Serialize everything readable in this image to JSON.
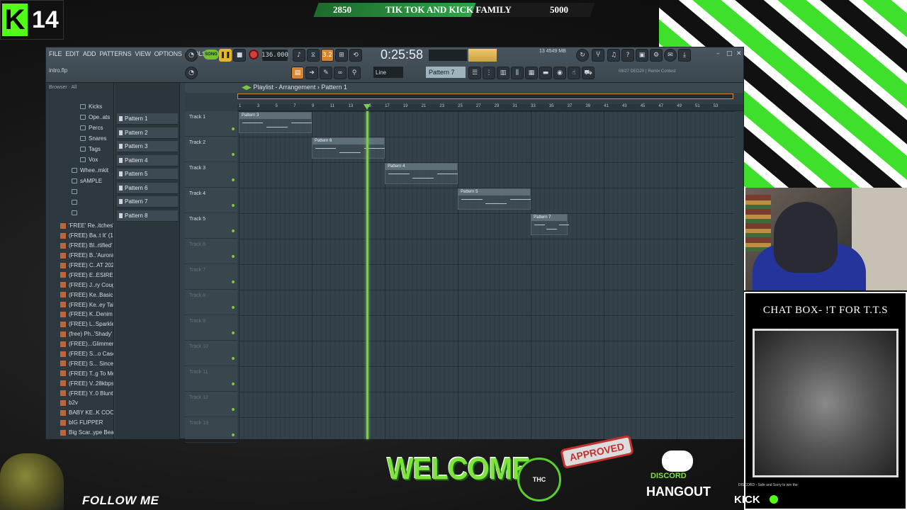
{
  "overlay": {
    "kick_logo": "K",
    "follower_count": "14",
    "goal": {
      "current": "2850",
      "title": "TIK TOK AND KICK FAMILY",
      "target": "5000",
      "progress": 0.57
    },
    "chat_box_title": "CHAT BOX- !T FOR T.T.S",
    "follow_text": "FOLLOW ME",
    "welcome_text": "WELCOME",
    "approved_text": "APPROVED",
    "kfc_text": "THC",
    "discord_label": "DISCORD",
    "hangout_text": "HANGOUT",
    "kick_footer": "KICK",
    "chat_ticker": "DISCORD - Safe and Sorry to win the",
    "stripe_colors": [
      "#3ee02c",
      "#111111"
    ]
  },
  "fl": {
    "menu": [
      "FILE",
      "EDIT",
      "ADD",
      "PATTERNS",
      "VIEW",
      "OPTIONS",
      "TOOLS",
      "HELP"
    ],
    "hint": "intro.flp",
    "song_mode": "SONG",
    "bpm": "136.000",
    "time": "0:25:58",
    "memory": "4549 MB",
    "cpu_count": "13",
    "snap": "Line",
    "pattern_selector": "Pattern 7",
    "news": "08/27  DEDZII | Remix Contest",
    "step_label": "3.2"
  },
  "browser": {
    "header": "Browser · All",
    "folders": [
      {
        "label": "Kicks",
        "indent": 1
      },
      {
        "label": "Ope..ats",
        "indent": 1
      },
      {
        "label": "Percs",
        "indent": 1
      },
      {
        "label": "Snares",
        "indent": 1
      },
      {
        "label": "Tags",
        "indent": 1
      },
      {
        "label": "Vox",
        "indent": 1
      },
      {
        "label": "Whee..mkit",
        "indent": 0
      },
      {
        "label": "sAMPLE",
        "indent": 0
      },
      {
        "label": "",
        "indent": 0
      },
      {
        "label": "",
        "indent": 0
      },
      {
        "label": "",
        "indent": 0
      }
    ],
    "files": [
      "'FREE' Re..itches'",
      "(FREE) Ba..t It' (1)",
      "(FREE) Bl..rtified'",
      "(FREE) B..'Aurora'",
      "(FREE) C..AT 2023",
      "(FREE) E..ESIRES'",
      "(FREE) J..ry Cough",
      "(FREE) Ke..Basics'",
      "(FREE) Ke..ey Talk'",
      "(FREE) K..Denim",
      "(FREE) L..Sparkle'",
      "(free) Ph..'Shady'",
      "(FREE)...Glimmer'",
      "(FREE) S...o Case",
      "(FREE) S... Since6",
      "(FREE) T..g To Me'",
      "(FREE) V..28kbps)",
      "(FREE) Y..0 Blunt'",
      "b2v",
      "BABY KE..K COOL'",
      "bIG FLIPPER",
      "Big Scar..ype Beat"
    ]
  },
  "picker": [
    "Pattern 1",
    "Pattern 2",
    "Pattern 3",
    "Pattern 4",
    "Pattern 5",
    "Pattern 6",
    "Pattern 7",
    "Pattern 8"
  ],
  "playlist": {
    "title": "Playlist - Arrangement",
    "pattern": "Pattern 1",
    "ruler": [
      "1",
      "3",
      "5",
      "7",
      "9",
      "11",
      "13",
      "15",
      "17",
      "19",
      "21",
      "23",
      "25",
      "27",
      "29",
      "31",
      "33",
      "35",
      "37",
      "39",
      "41",
      "43",
      "45",
      "47",
      "49",
      "51",
      "53"
    ],
    "tracks": [
      "Track 1",
      "Track 2",
      "Track 3",
      "Track 4",
      "Track 5",
      "Track 6",
      "Track 7",
      "Track 8",
      "Track 9",
      "Track 10",
      "Track 11",
      "Track 12",
      "Track 13"
    ],
    "clips": [
      {
        "name": "Pattern 3",
        "track": 0,
        "start": 1,
        "length": 8
      },
      {
        "name": "Pattern 6",
        "track": 1,
        "start": 9,
        "length": 8
      },
      {
        "name": "Pattern 4",
        "track": 2,
        "start": 17,
        "length": 8
      },
      {
        "name": "Pattern 5",
        "track": 3,
        "start": 25,
        "length": 8
      },
      {
        "name": "Pattern 7",
        "track": 4,
        "start": 33,
        "length": 4
      }
    ],
    "playhead_bar": 15
  }
}
